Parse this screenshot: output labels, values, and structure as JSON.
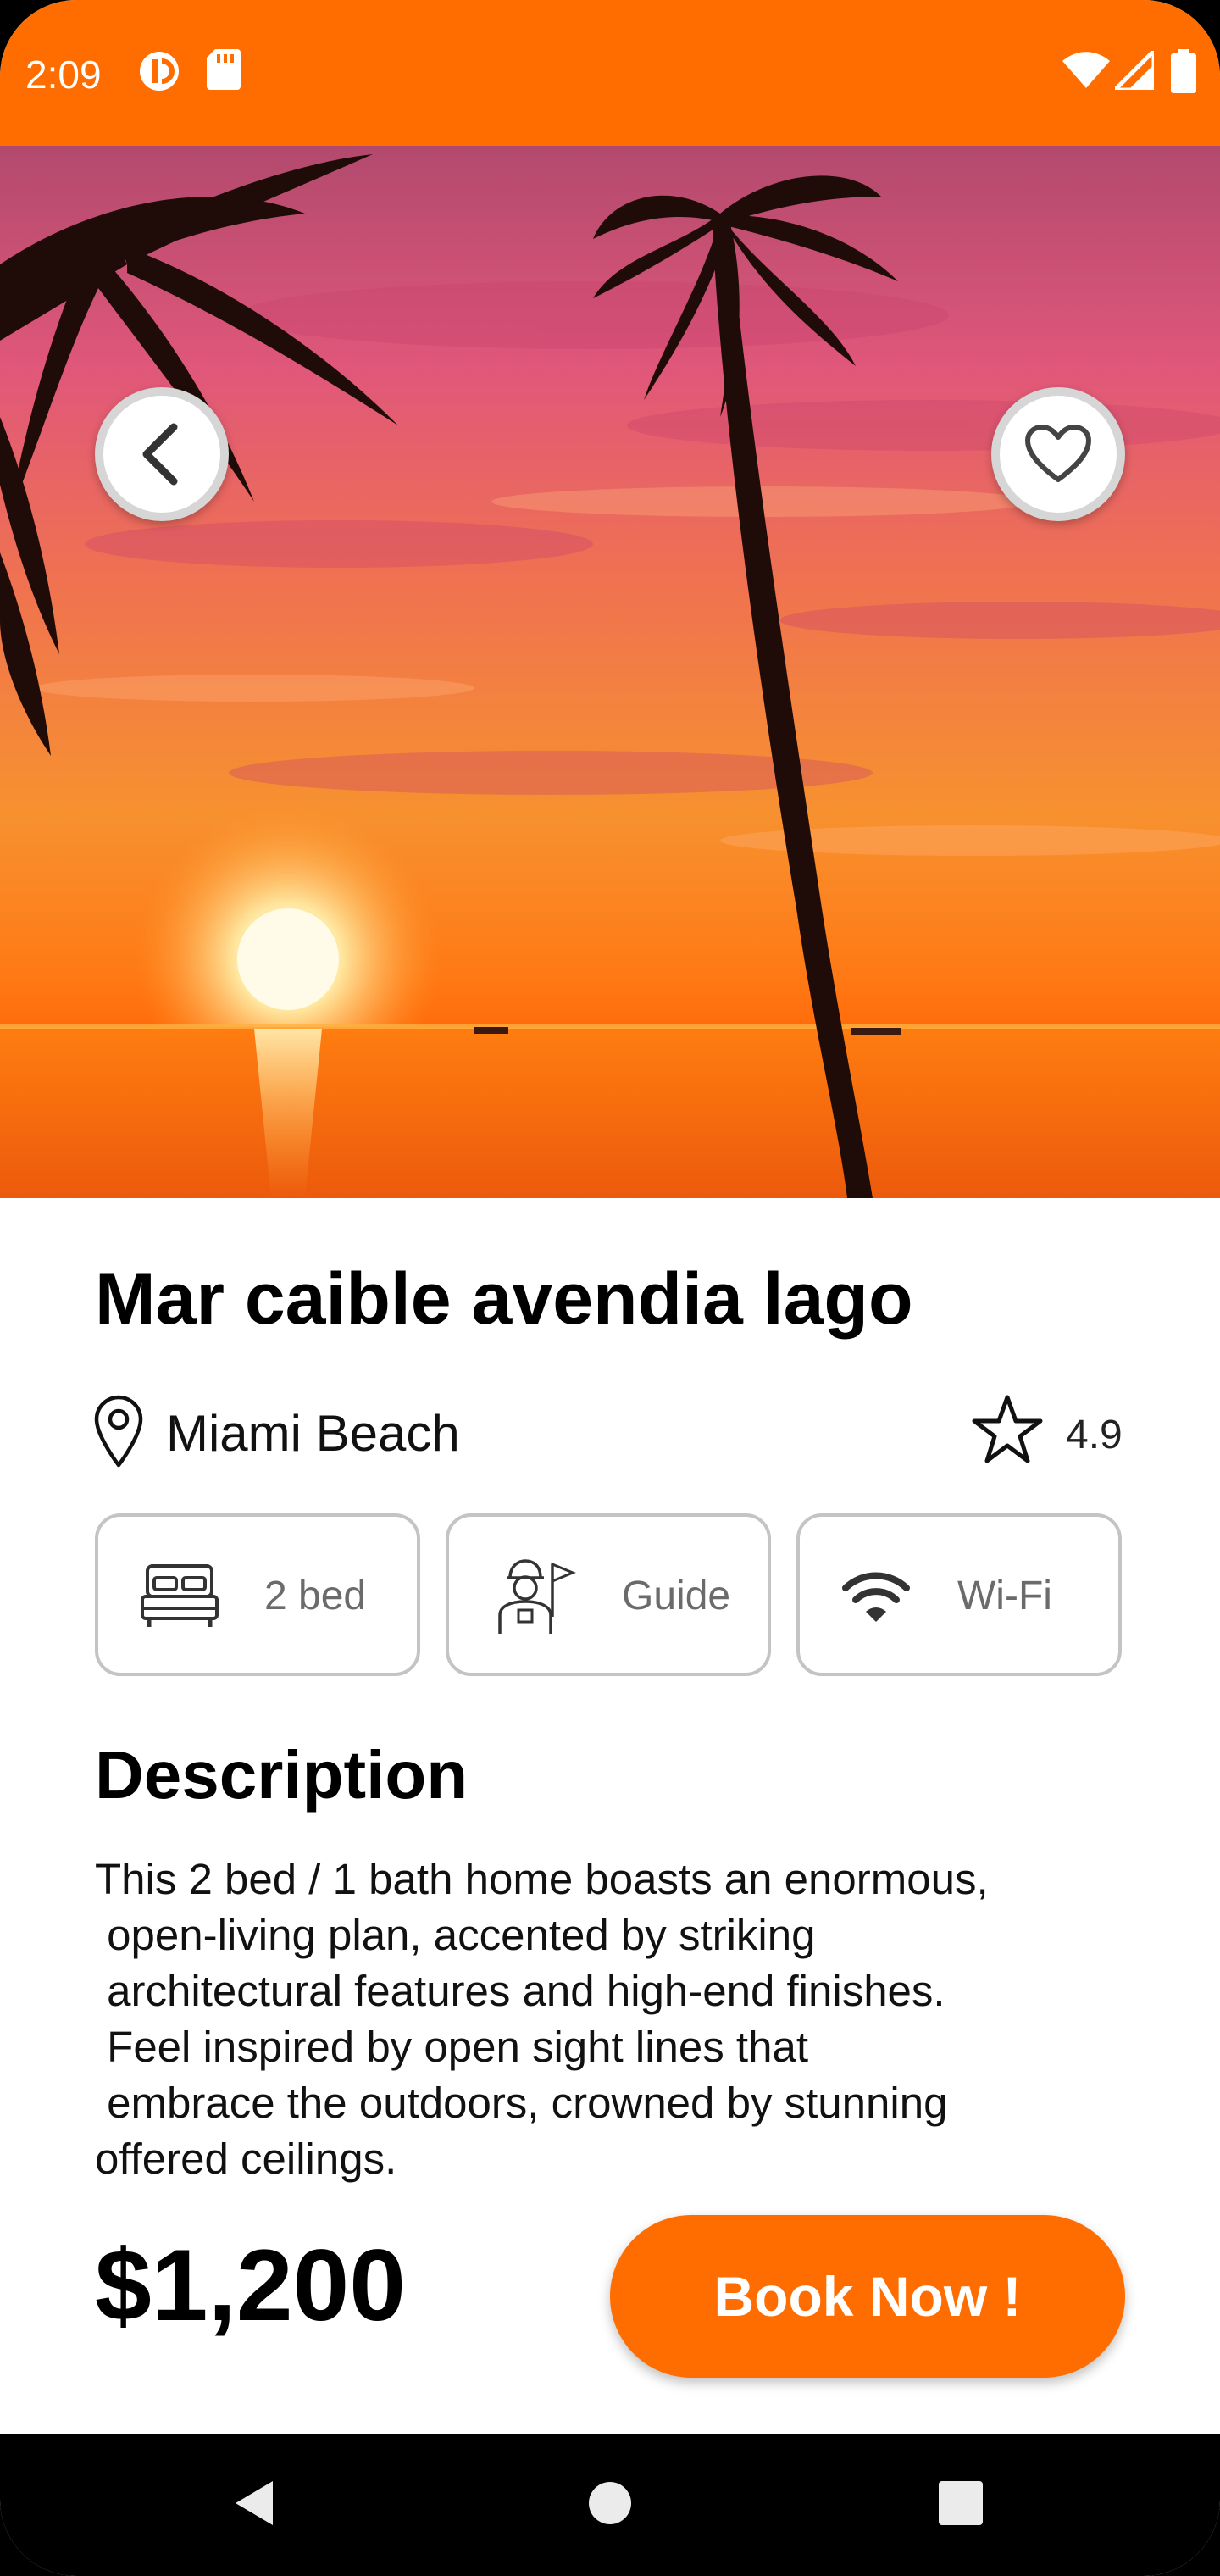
{
  "status_bar": {
    "time": "2:09",
    "background_color": "#FF6D00",
    "left_icons": [
      "data-saver-icon",
      "sd-card-icon"
    ],
    "right_icons": [
      "wifi-icon",
      "cell-signal-icon",
      "battery-icon"
    ]
  },
  "hero": {
    "image_description_icon": "sunset-beach-palm-trees-image",
    "back_icon": "chevron-left-icon",
    "favorite_icon": "heart-outline-icon"
  },
  "listing": {
    "title": "Mar caible avendia lago",
    "location": "Miami Beach",
    "rating": "4.9",
    "amenities": [
      {
        "icon": "bed-icon",
        "label": "2 bed"
      },
      {
        "icon": "guide-person-icon",
        "label": "Guide"
      },
      {
        "icon": "wifi-icon",
        "label": "Wi-Fi"
      }
    ],
    "description_heading": "Description",
    "description_lines": [
      "This 2 bed / 1 bath home boasts an enormous,",
      " open-living plan, accented by striking",
      " architectural features and high-end finishes.",
      " Feel inspired by open sight lines that",
      " embrace the outdoors, crowned by stunning",
      "offered ceilings."
    ],
    "price": "$1,200",
    "book_label": "Book Now !"
  },
  "colors": {
    "accent": "#FF6D00",
    "text": "#000000",
    "border": "#C4C4C4"
  },
  "nav_bar": {
    "items": [
      "nav-back-icon",
      "nav-home-icon",
      "nav-recents-icon"
    ]
  }
}
